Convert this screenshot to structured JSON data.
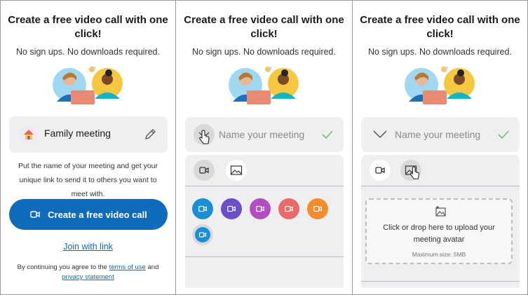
{
  "common": {
    "title": "Create a free video call with one click!",
    "subtitle": "No sign ups. No downloads required."
  },
  "panel1": {
    "meeting_name": "Family meeting",
    "description": "Put the name of your meeting and get your unique link to send it to others you want to meet with.",
    "cta_label": "Create a free video call",
    "join_link": "Join with link",
    "legal_prefix": "By continuing you agree to the ",
    "terms_link": "terms of use",
    "legal_and": " and",
    "privacy_link": "privacy statement"
  },
  "panel2": {
    "name_placeholder": "Name your meeting",
    "colors": [
      "#1b8fd6",
      "#6a4fc9",
      "#b54dc2",
      "#e86a6a",
      "#f28c2d",
      "#1b8fd6"
    ]
  },
  "panel3": {
    "name_placeholder": "Name your meeting",
    "upload_text": "Click or drop here to upload your meeting avatar",
    "upload_max": "Maximum size: 5MB"
  },
  "colors": {
    "accent": "#0f6cbd",
    "card_bg": "#efeff1",
    "check_green": "#6bbf72"
  }
}
